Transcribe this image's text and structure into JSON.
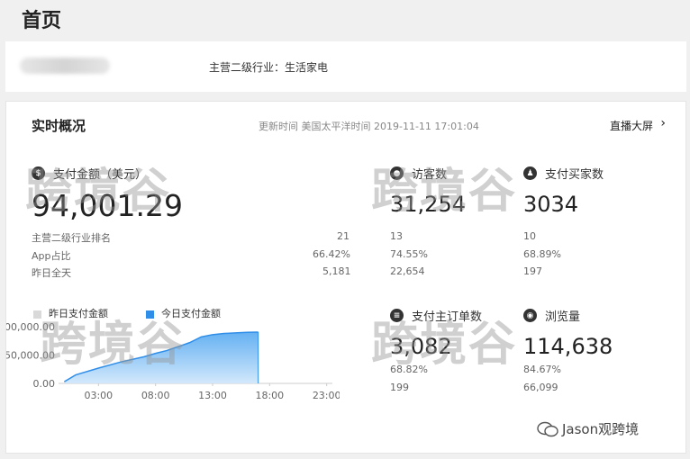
{
  "header": {
    "title": "首页"
  },
  "shop": {
    "industry_text": "主营二级行业：生活家电"
  },
  "overview": {
    "title": "实时概况",
    "update_time": "更新时间 美国太平洋时间 2019-11-11 17:01:04",
    "live_link": "直播大屏",
    "live_arrow": "›"
  },
  "payment": {
    "icon": "dollar-icon",
    "label": "支付金额（美元）",
    "value": "94,001.29",
    "rows": [
      {
        "label": "主营二级行业排名",
        "value": "21"
      },
      {
        "label": "App占比",
        "value": "66.42%"
      },
      {
        "label": "昨日全天",
        "value": "5,181"
      }
    ]
  },
  "visitors": {
    "icon": "footprint-icon",
    "label": "访客数",
    "value": "31,254",
    "rows": [
      "13",
      "74.55%",
      "22,654"
    ]
  },
  "buyers": {
    "icon": "user-group-icon",
    "label": "支付买家数",
    "value": "3034",
    "rows": [
      "10",
      "68.89%",
      "197"
    ]
  },
  "orders": {
    "icon": "order-icon",
    "label": "支付主订单数",
    "value": "3,082",
    "rows": [
      "68.82%",
      "199"
    ]
  },
  "pageviews": {
    "icon": "eye-icon",
    "label": "浏览量",
    "value": "114,638",
    "rows": [
      "84.67%",
      "66,099"
    ]
  },
  "legend": {
    "yesterday": {
      "label": "昨日支付金额",
      "color": "#d9d9d9"
    },
    "today": {
      "label": "今日支付金额",
      "color": "#2f8ee8"
    }
  },
  "chart_data": {
    "type": "area",
    "x_ticks": [
      "03:00",
      "08:00",
      "13:00",
      "18:00",
      "23:00"
    ],
    "y_ticks": [
      "100,000.00",
      "50,000.00",
      "0.00"
    ],
    "ylim": [
      0,
      100000
    ],
    "xlim": [
      -0.5,
      23.5
    ],
    "series": [
      {
        "name": "今日支付金额",
        "color": "#2f8ee8",
        "x": [
          0,
          1,
          3,
          5,
          7,
          8,
          9,
          10,
          11,
          12,
          13,
          14,
          15,
          16,
          17
        ],
        "y": [
          3000,
          15000,
          27000,
          38000,
          47000,
          53000,
          58000,
          65000,
          72000,
          82000,
          86000,
          88000,
          89000,
          90000,
          90500
        ]
      }
    ]
  },
  "watermark": {
    "text": "跨境谷"
  },
  "brand": {
    "name": "Jason观跨境"
  }
}
